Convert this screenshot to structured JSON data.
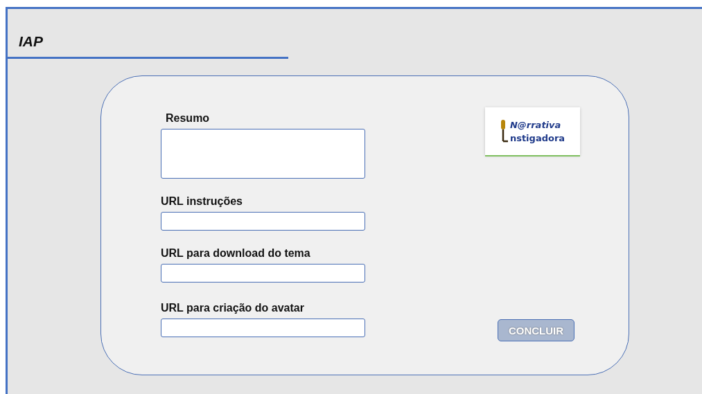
{
  "title": "IAP",
  "fields": [
    {
      "label": "Resumo",
      "kind": "textarea"
    },
    {
      "label": "URL instruções",
      "kind": "input"
    },
    {
      "label": "URL para download do tema",
      "kind": "input"
    },
    {
      "label": "URL para criação do avatar",
      "kind": "input"
    }
  ],
  "logo": {
    "line_1": "N@rrativa",
    "line_2": "nstigadora"
  },
  "button": "CONCLUIR"
}
